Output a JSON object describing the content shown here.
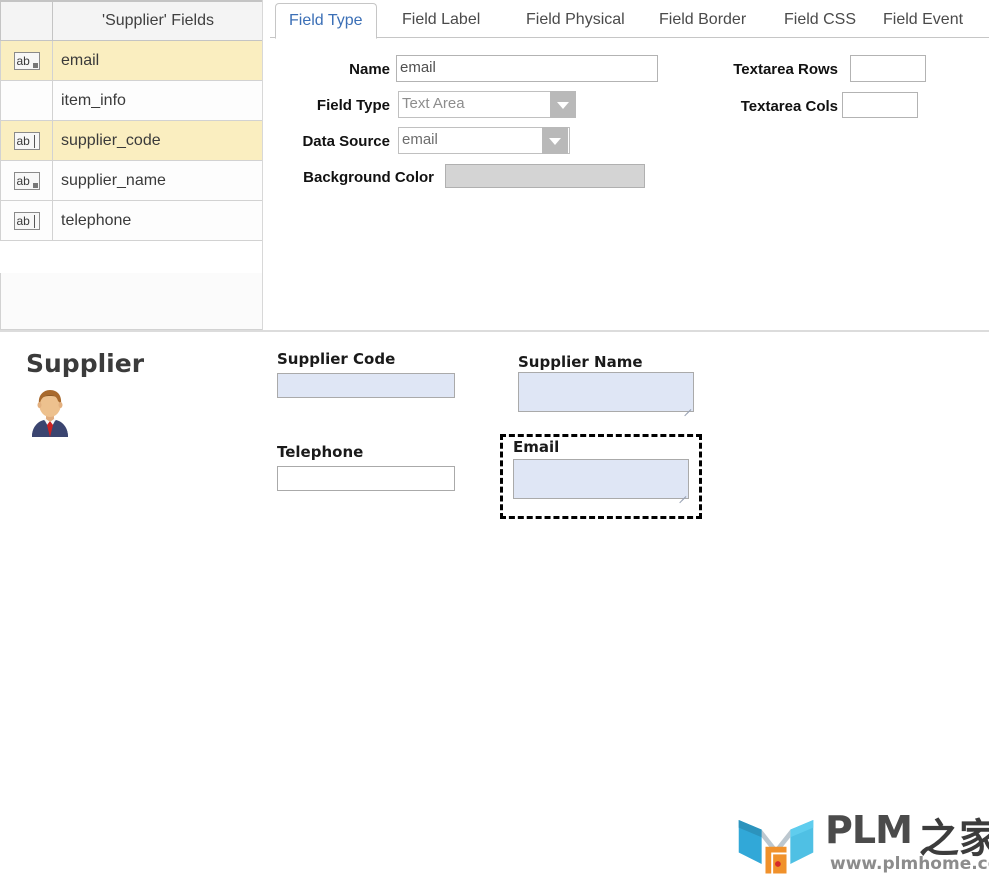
{
  "field_list": {
    "header": {
      "icon_col": "",
      "name_col": "'Supplier' Fields"
    },
    "rows": [
      {
        "icon": "textarea-icon",
        "name": "email",
        "selected": true,
        "has_icon": true,
        "icon_kind": "textarea"
      },
      {
        "icon": "",
        "name": "item_info",
        "selected": false,
        "has_icon": false,
        "icon_kind": "none"
      },
      {
        "icon": "textfield-icon",
        "name": "supplier_code",
        "selected": true,
        "has_icon": true,
        "icon_kind": "textfield"
      },
      {
        "icon": "textarea-icon",
        "name": "supplier_name",
        "selected": false,
        "has_icon": true,
        "icon_kind": "textarea"
      },
      {
        "icon": "textfield-icon",
        "name": "telephone",
        "selected": false,
        "has_icon": true,
        "icon_kind": "textfield"
      }
    ],
    "icon_glyph": "ab"
  },
  "tabs": [
    {
      "label": "Field Type",
      "active": true
    },
    {
      "label": "Field Label",
      "active": false
    },
    {
      "label": "Field Physical",
      "active": false
    },
    {
      "label": "Field Border",
      "active": false
    },
    {
      "label": "Field CSS",
      "active": false
    },
    {
      "label": "Field Event",
      "active": false
    }
  ],
  "field_type_form": {
    "name": {
      "label": "Name",
      "value": "email"
    },
    "field_type": {
      "label": "Field Type",
      "value": "Text Area"
    },
    "data_source": {
      "label": "Data Source",
      "value": "email"
    },
    "background_color": {
      "label": "Background Color",
      "value": ""
    },
    "textarea_rows": {
      "label": "Textarea Rows",
      "value": ""
    },
    "textarea_cols": {
      "label": "Textarea Cols",
      "value": ""
    }
  },
  "preview": {
    "title": "Supplier",
    "avatar": "supplier-avatar-icon",
    "fields": [
      {
        "label": "Supplier Code",
        "value": "",
        "kind": "input",
        "filled": true
      },
      {
        "label": "Supplier Name",
        "value": "",
        "kind": "textarea",
        "filled": true
      },
      {
        "label": "Telephone",
        "value": "",
        "kind": "input",
        "filled": false
      },
      {
        "label": "Email",
        "value": "",
        "kind": "textarea",
        "filled": true,
        "selected": true
      }
    ]
  },
  "watermark": {
    "text": "PLM",
    "cn": "之家",
    "url": "www.plmhome.com"
  },
  "colors": {
    "row_selected": "#faeec0",
    "tab_active_text": "#3b6fb6",
    "preview_input_fill": "#dfe6f5",
    "swatch_disabled": "#d4d4d4"
  }
}
